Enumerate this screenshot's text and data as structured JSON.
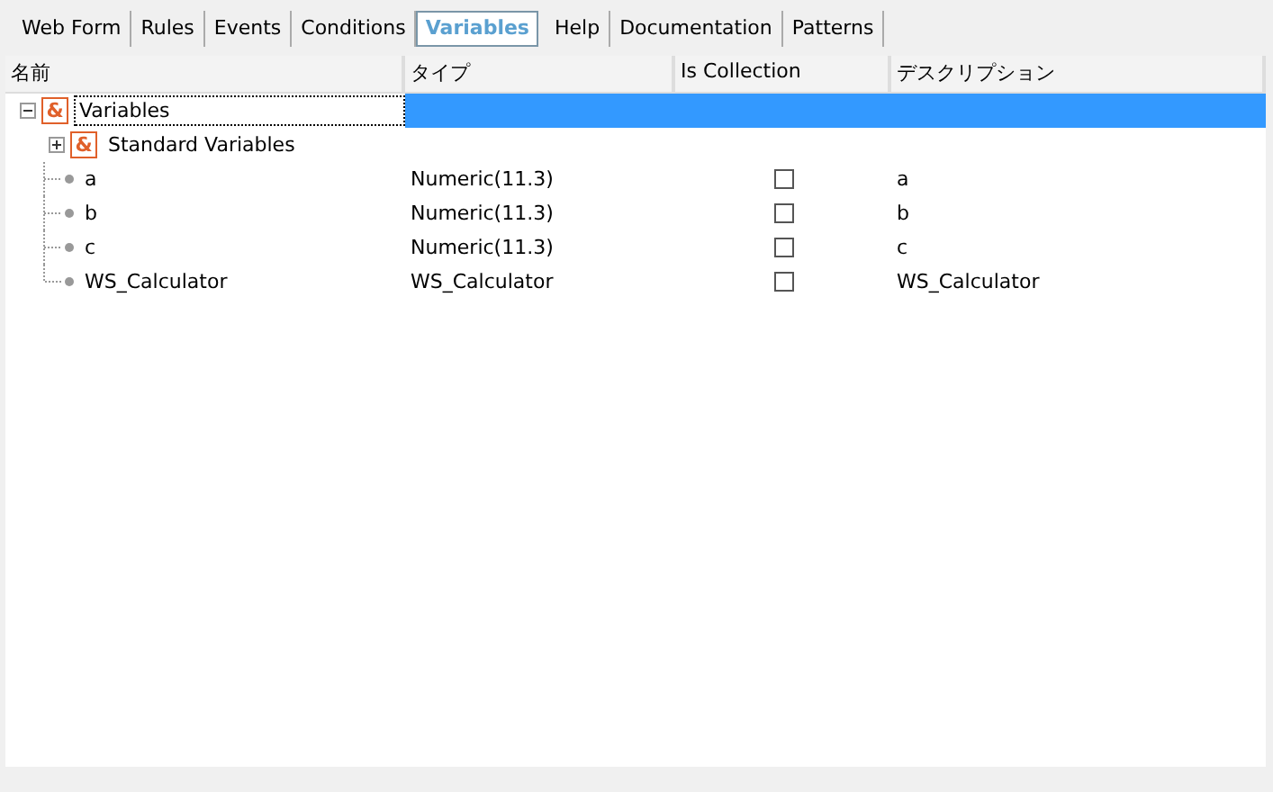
{
  "tabs": [
    {
      "label": "Web Form",
      "selected": false
    },
    {
      "label": "Rules",
      "selected": false
    },
    {
      "label": "Events",
      "selected": false
    },
    {
      "label": "Conditions",
      "selected": false
    },
    {
      "label": "Variables",
      "selected": true
    },
    {
      "label": "Help",
      "selected": false
    },
    {
      "label": "Documentation",
      "selected": false
    },
    {
      "label": "Patterns",
      "selected": false
    }
  ],
  "table": {
    "columns": [
      "名前",
      "タイプ",
      "Is Collection",
      "デスクリプション"
    ],
    "rows": [
      {
        "kind": "group",
        "icon": "&",
        "name": "Variables",
        "expanded": true,
        "selected": true,
        "children": [
          {
            "kind": "group",
            "icon": "&",
            "name": "Standard Variables",
            "expanded": false,
            "selected": false
          },
          {
            "kind": "variable",
            "name": "a",
            "type": "Numeric(11.3)",
            "is_collection": false,
            "description": "a",
            "selected": false
          },
          {
            "kind": "variable",
            "name": "b",
            "type": "Numeric(11.3)",
            "is_collection": false,
            "description": "b",
            "selected": false
          },
          {
            "kind": "variable",
            "name": "c",
            "type": "Numeric(11.3)",
            "is_collection": false,
            "description": "c",
            "selected": false
          },
          {
            "kind": "variable",
            "name": "WS_Calculator",
            "type": "WS_Calculator",
            "is_collection": false,
            "description": "WS_Calculator",
            "selected": false
          }
        ]
      }
    ]
  }
}
